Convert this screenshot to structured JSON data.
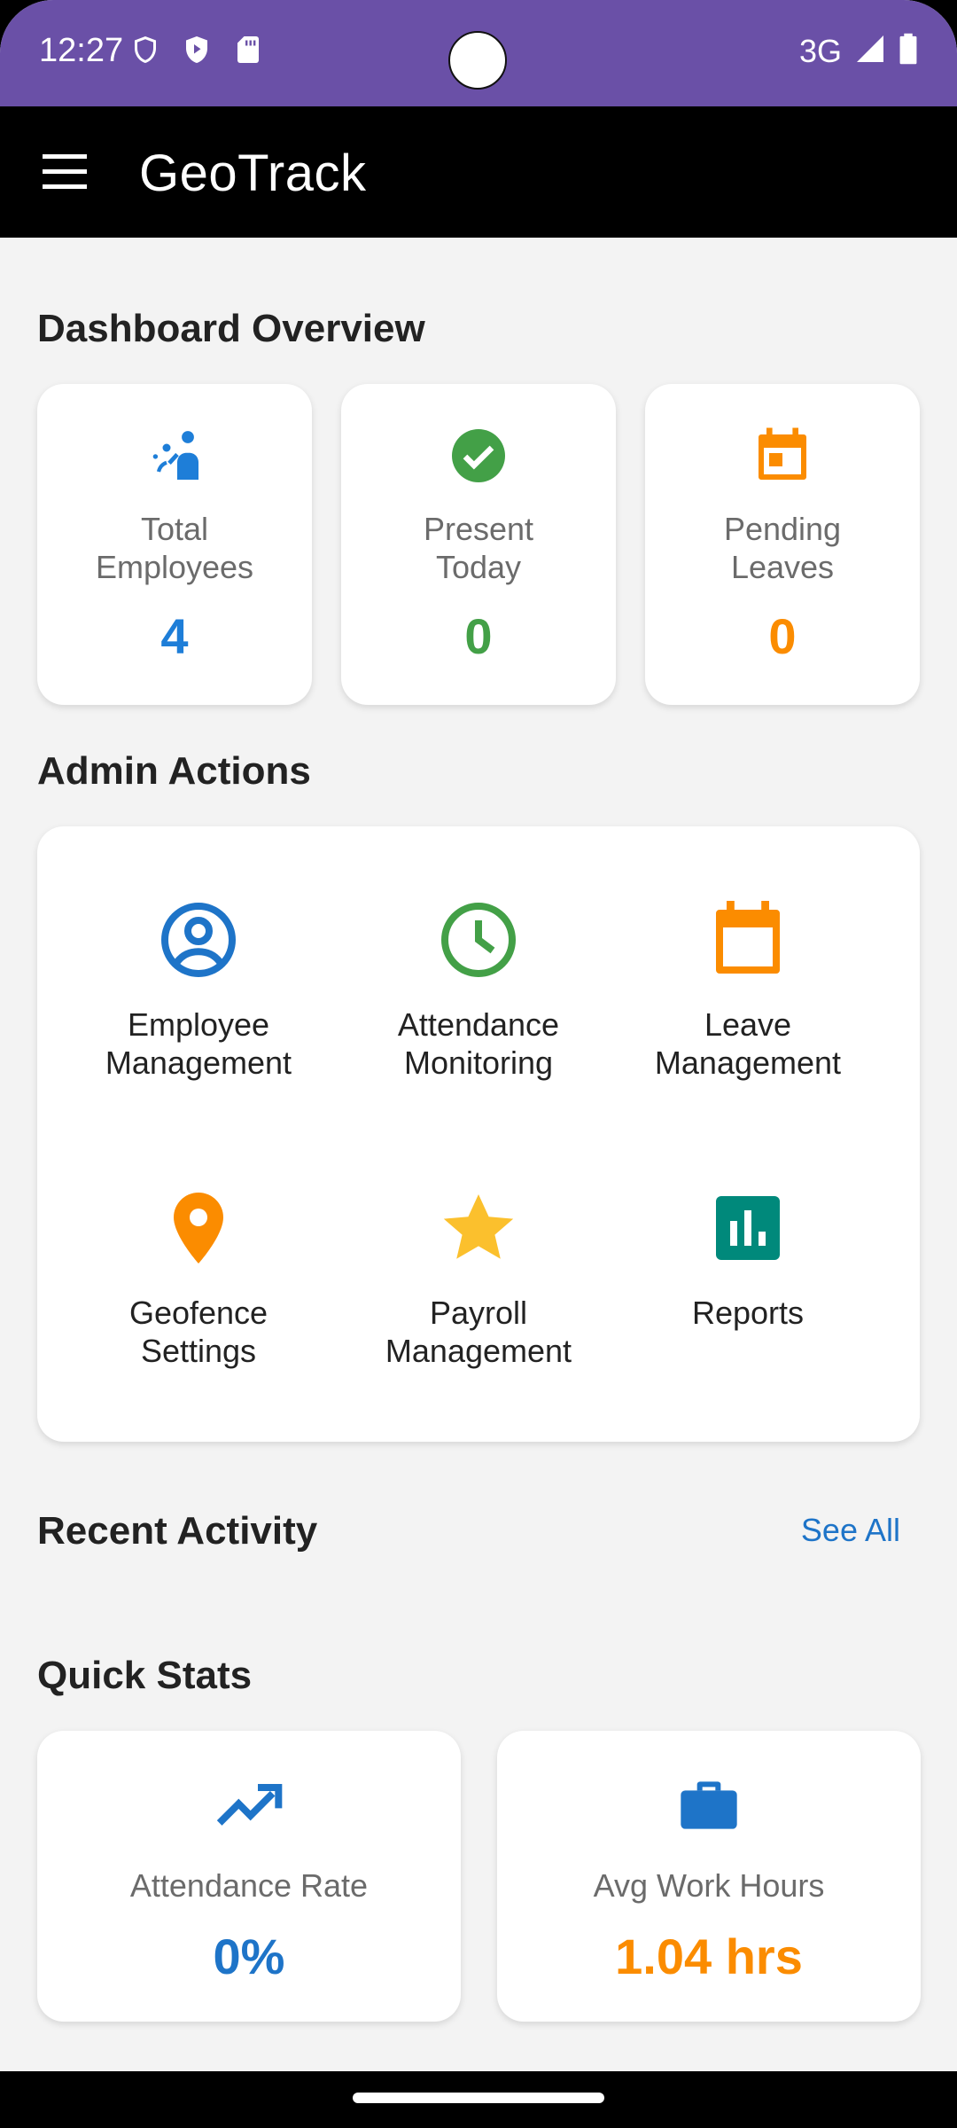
{
  "status_bar": {
    "time": "12:27",
    "network": "3G",
    "icons": [
      "shield-icon",
      "play-protect-icon",
      "sd-card-icon",
      "signal-icon",
      "battery-icon"
    ]
  },
  "app_bar": {
    "title": "GeoTrack",
    "menu_icon": "hamburger-menu-icon"
  },
  "dashboard": {
    "title": "Dashboard Overview",
    "cards": [
      {
        "label": "Total\nEmployees",
        "value": "4",
        "icon": "people-icon",
        "color": "#1e7ed8"
      },
      {
        "label": "Present\nToday",
        "value": "0",
        "icon": "check-circle-icon",
        "color": "#43a047"
      },
      {
        "label": "Pending\nLeaves",
        "value": "0",
        "icon": "calendar-icon",
        "color": "#fb8c00"
      }
    ]
  },
  "admin_actions": {
    "title": "Admin Actions",
    "items": [
      {
        "label": "Employee\nManagement",
        "icon": "account-circle-icon",
        "color": "#1e74c8"
      },
      {
        "label": "Attendance\nMonitoring",
        "icon": "clock-icon",
        "color": "#43a047"
      },
      {
        "label": "Leave\nManagement",
        "icon": "calendar-icon",
        "color": "#fb8c00"
      },
      {
        "label": "Geofence\nSettings",
        "icon": "location-pin-icon",
        "color": "#fb8c00"
      },
      {
        "label": "Payroll\nManagement",
        "icon": "star-icon",
        "color": "#fbc02d"
      },
      {
        "label": "Reports",
        "icon": "bar-chart-icon",
        "color": "#00897b"
      }
    ]
  },
  "recent_activity": {
    "title": "Recent Activity",
    "see_all": "See All"
  },
  "quick_stats": {
    "title": "Quick Stats",
    "cards": [
      {
        "label": "Attendance Rate",
        "value": "0%",
        "icon": "trending-up-icon",
        "color": "#1e74c8"
      },
      {
        "label": "Avg Work Hours",
        "value": "1.04 hrs",
        "icon": "briefcase-icon",
        "color": "#fb8c00"
      }
    ]
  }
}
